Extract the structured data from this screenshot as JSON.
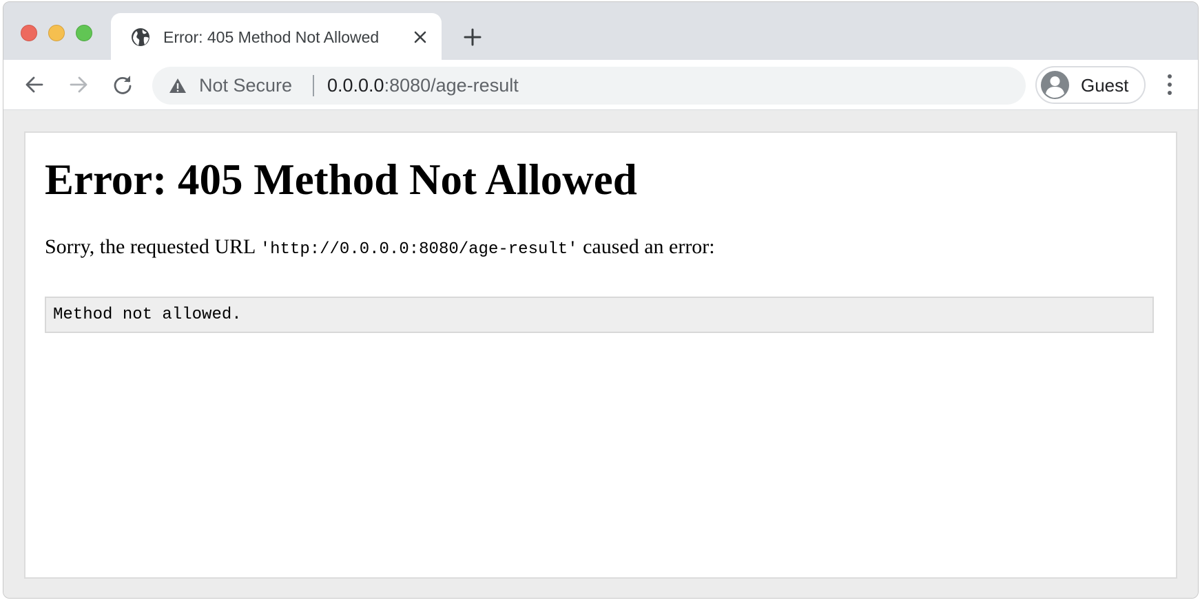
{
  "tab": {
    "title": "Error: 405 Method Not Allowed",
    "favicon_icon": "globe-icon",
    "close_icon": "close-icon"
  },
  "new_tab_icon": "plus-icon",
  "traffic_lights": {
    "close_color": "#ed6a5e",
    "minimize_color": "#f5bf4f",
    "maximize_color": "#61c554"
  },
  "toolbar": {
    "back_icon": "arrow-left-icon",
    "forward_icon": "arrow-right-icon",
    "reload_icon": "reload-icon",
    "security_icon": "warning-triangle-icon",
    "security_label": "Not Secure",
    "url_host": "0.0.0.0",
    "url_rest": ":8080/age-result",
    "profile_name": "Guest",
    "profile_icon": "person-avatar-icon",
    "menu_icon": "more-vertical-icon"
  },
  "page": {
    "title": "Error: 405 Method Not Allowed",
    "message_prefix": "Sorry, the requested URL ",
    "message_url": "'http://0.0.0.0:8080/age-result'",
    "message_suffix": " caused an error:",
    "error_detail": "Method not allowed."
  }
}
